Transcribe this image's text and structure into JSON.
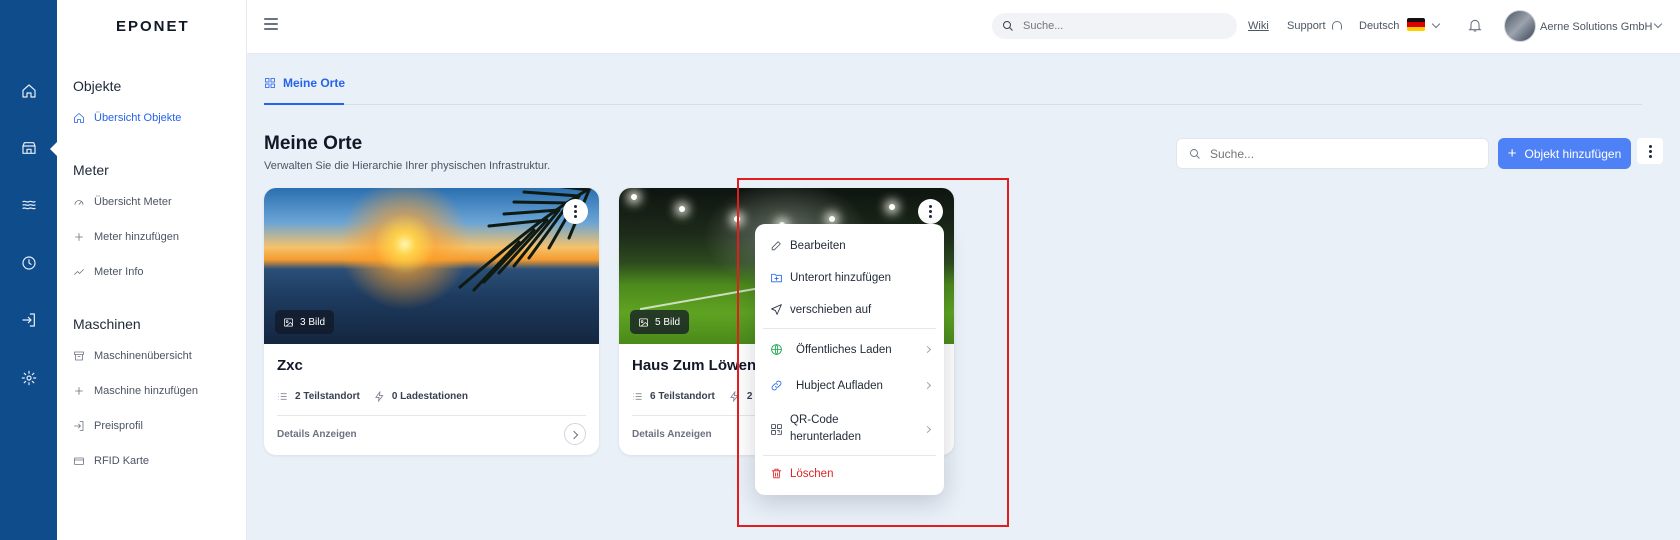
{
  "brand": "EPONET",
  "rail": {
    "items": [
      {
        "icon": "home-icon"
      },
      {
        "icon": "store-icon"
      },
      {
        "icon": "waves-icon"
      },
      {
        "icon": "clock-icon"
      },
      {
        "icon": "login-icon"
      },
      {
        "icon": "gear-icon"
      }
    ]
  },
  "sidebar": {
    "objekte_title": "Objekte",
    "objekte_overview": "Übersicht Objekte",
    "meter_title": "Meter",
    "meter_overview": "Übersicht Meter",
    "meter_add": "Meter hinzufügen",
    "meter_info": "Meter Info",
    "maschinen_title": "Maschinen",
    "maschinen_overview": "Maschinenübersicht",
    "maschine_add": "Maschine hinzufügen",
    "preisprofil": "Preisprofil",
    "rfid": "RFID Karte"
  },
  "header": {
    "search_placeholder": "Suche...",
    "wiki": "Wiki",
    "support": "Support",
    "language": "Deutsch",
    "company": "Aerne Solutions GmbH"
  },
  "main": {
    "tab": "Meine Orte",
    "title": "Meine Orte",
    "subtitle": "Verwalten Sie die Hierarchie Ihrer physischen Infrastruktur.",
    "search_placeholder": "Suche...",
    "add_button": "Objekt hinzufügen"
  },
  "cards": [
    {
      "title": "Zxc",
      "image_count": "3 Bild",
      "teilstandort": "2 Teilstandort",
      "ladestationen": "0 Ladestationen",
      "details": "Details Anzeigen"
    },
    {
      "title": "Haus Zum Löwen",
      "image_count": "5 Bild",
      "teilstandort": "6 Teilstandort",
      "ladestationen": "2",
      "details": "Details Anzeigen"
    }
  ],
  "dropdown": {
    "edit": "Bearbeiten",
    "add_sublocation": "Unterort hinzufügen",
    "move_to": "verschieben auf",
    "public_charging": "Öffentliches Laden",
    "hubject": "Hubject Aufladen",
    "qr_download": "QR-Code herunterladen",
    "delete": "Löschen"
  },
  "colors": {
    "rail": "#0f4c8b",
    "accent": "#2563eb",
    "button": "#4f81f6",
    "danger": "#dc2626",
    "highlight": "#e11d1d"
  }
}
